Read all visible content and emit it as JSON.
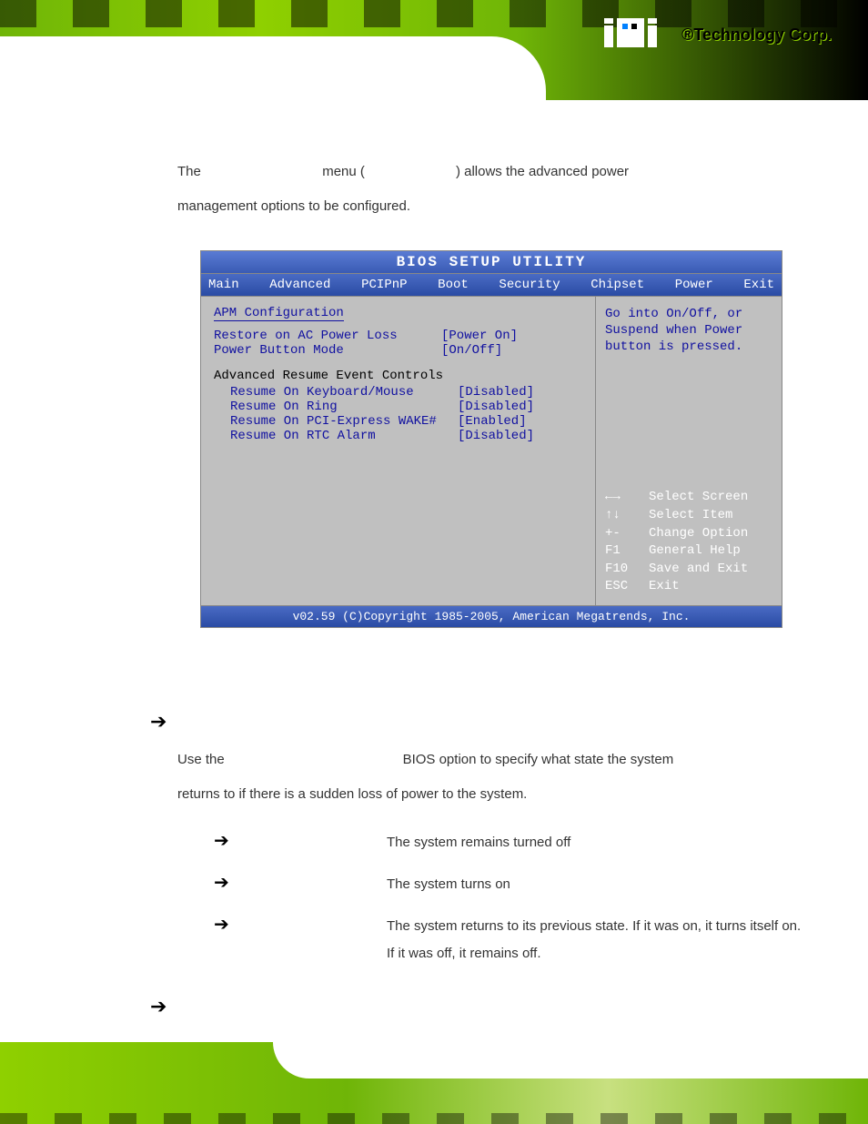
{
  "header": {
    "brand_text": "Technology Corp.",
    "reg": "®"
  },
  "intro": {
    "p1a": "The",
    "p1b": "menu  (",
    "p1c": ")  allows  the  advanced  power",
    "p2": "management options to be configured."
  },
  "bios": {
    "title": "BIOS SETUP UTILITY",
    "tabs": [
      "Main",
      "Advanced",
      "PCIPnP",
      "Boot",
      "Security",
      "Chipset",
      "Power",
      "Exit"
    ],
    "left": {
      "section": "APM Configuration",
      "rows": [
        {
          "label": "Restore on AC Power Loss",
          "value": "[Power On]"
        },
        {
          "label": "Power Button Mode",
          "value": "[On/Off]"
        }
      ],
      "subhead": "Advanced Resume Event Controls",
      "subrows": [
        {
          "label": "Resume On Keyboard/Mouse",
          "value": "[Disabled]"
        },
        {
          "label": "Resume On Ring",
          "value": "[Disabled]"
        },
        {
          "label": "Resume On PCI-Express WAKE#",
          "value": "[Enabled]"
        },
        {
          "label": "Resume On RTC Alarm",
          "value": "[Disabled]"
        }
      ]
    },
    "right": {
      "help": "Go into On/Off, or Suspend when Power button is pressed.",
      "keys": [
        {
          "k": "←→",
          "d": "Select Screen"
        },
        {
          "k": "↑↓",
          "d": "Select Item"
        },
        {
          "k": "+-",
          "d": "Change Option"
        },
        {
          "k": "F1",
          "d": "General Help"
        },
        {
          "k": "F10",
          "d": "Save and Exit"
        },
        {
          "k": "ESC",
          "d": "Exit"
        }
      ]
    },
    "footer": "v02.59 (C)Copyright 1985-2005, American Megatrends, Inc."
  },
  "section2": {
    "p1a": "Use  the",
    "p1b": "BIOS  option  to  specify  what  state  the  system",
    "p2": "returns to if there is a sudden loss of power to the system.",
    "options": [
      {
        "desc": "The system remains turned off"
      },
      {
        "desc": "The system turns on"
      },
      {
        "desc": "The system returns to its previous state. If it was on, it turns itself on. If it was off, it remains off."
      }
    ]
  },
  "arrow_glyph": "➔"
}
